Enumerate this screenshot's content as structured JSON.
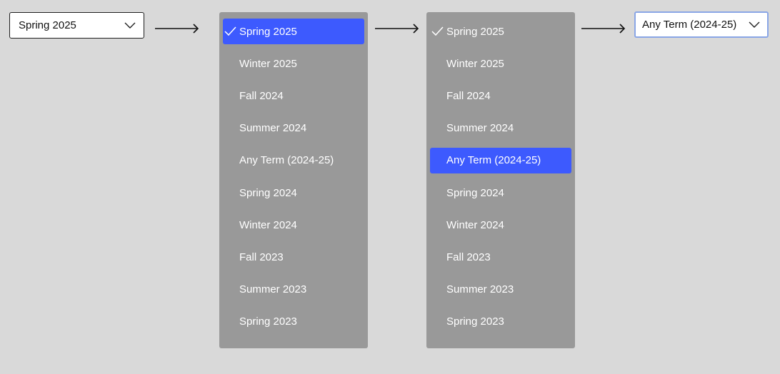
{
  "step1": {
    "selected_value": "Spring 2025",
    "icon": "chevron-down-icon"
  },
  "menu_items": [
    "Spring 2025",
    "Winter 2025",
    "Fall 2024",
    "Summer 2024",
    "Any Term (2024-25)",
    "Spring 2024",
    "Winter 2024",
    "Fall 2023",
    "Summer 2023",
    "Spring 2023"
  ],
  "step2": {
    "checked_item": "Spring 2025",
    "highlighted_item": "Spring 2025"
  },
  "step3": {
    "checked_item": "Spring 2025",
    "highlighted_item": "Any Term (2024-25)"
  },
  "step4": {
    "selected_value": "Any Term (2024-25)",
    "icon": "chevron-down-icon"
  },
  "colors": {
    "background": "#d9d9d9",
    "menu_background": "#999999",
    "highlight": "#3d5afe",
    "focus_border": "#8aa6e6",
    "text_on_menu": "#ffffff"
  },
  "icons": {
    "arrow": "arrow-right-icon",
    "check": "checkmark-icon"
  }
}
